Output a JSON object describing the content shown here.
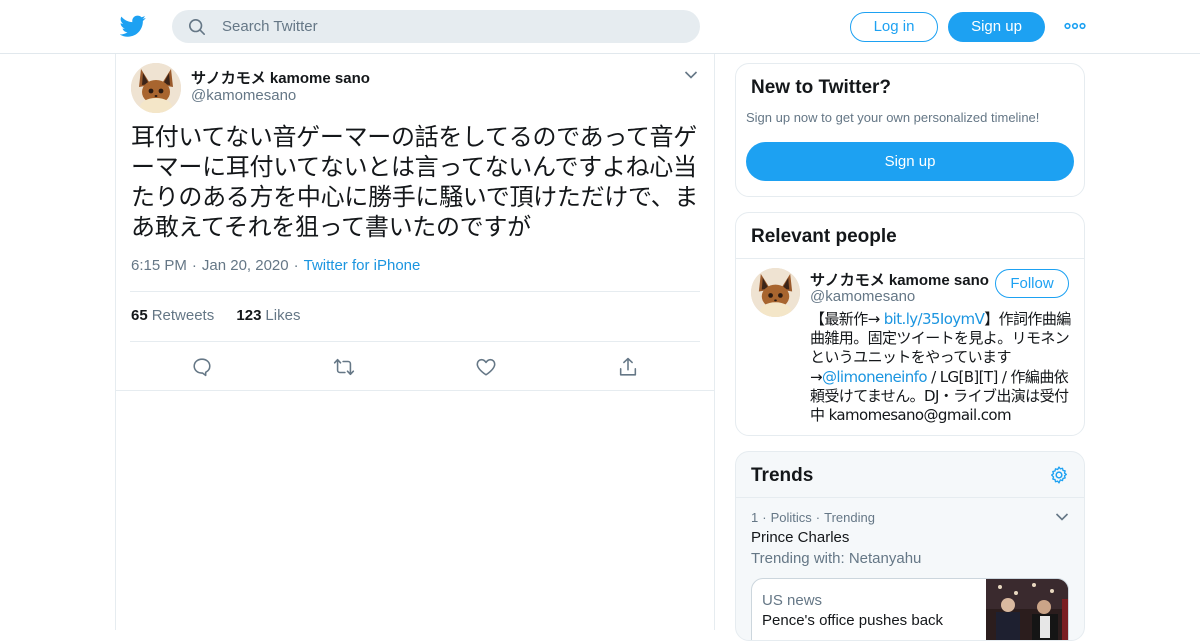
{
  "header": {
    "logo_icon": "twitter-bird-icon",
    "search": {
      "placeholder": "Search Twitter",
      "icon": "search-icon"
    },
    "login_label": "Log in",
    "signup_label": "Sign up",
    "more_icon": "more-dots-icon",
    "brand_color": "#1da1f2"
  },
  "tweet": {
    "author": {
      "display_name": "サノカモメ kamome sano",
      "handle": "@kamomesano",
      "avatar": "eevee-avatar"
    },
    "text": "耳付いてない音ゲーマーの話をしてるのであって音ゲーマーに耳付いてないとは言ってないんですよね心当たりのある方を中心に勝手に騒いで頂けただけで、まあ敢えてそれを狙って書いたのですが",
    "time": "6:15 PM",
    "date": "Jan 20, 2020",
    "source": "Twitter for iPhone",
    "separator": "·",
    "retweets_count": "65",
    "retweets_label": "Retweets",
    "likes_count": "123",
    "likes_label": "Likes",
    "actions": [
      "reply-icon",
      "retweet-icon",
      "like-icon",
      "share-icon"
    ]
  },
  "sidebar": {
    "new_to_twitter": {
      "title": "New to Twitter?",
      "subtitle": "Sign up now to get your own personalized timeline!",
      "signup_label": "Sign up"
    },
    "relevant_people": {
      "title": "Relevant people",
      "person": {
        "display_name": "サノカモメ kamome sano",
        "handle": "@kamomesano",
        "follow_label": "Follow",
        "bio_1": "【最新作→ ",
        "bio_link_1": "bit.ly/35IoymV",
        "bio_2": "】作詞作曲編曲雑用。固定ツイートを見よ。リモネンというユニットをやっています→",
        "bio_link_2": "@limoneneinfo",
        "bio_3": " / LG[B][T] / 作編曲依頼受けてません。DJ・ライブ出演は受付中 kamomesano@gmail.com"
      }
    },
    "trends": {
      "title": "Trends",
      "items": [
        {
          "rank": "1",
          "category": "Politics",
          "status": "Trending",
          "name": "Prince Charles",
          "with": "Trending with: Netanyahu",
          "news": {
            "source": "US news",
            "headline": "Pence's office pushes back"
          }
        }
      ]
    }
  }
}
